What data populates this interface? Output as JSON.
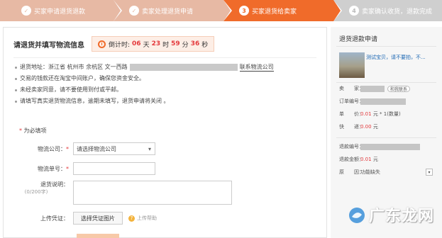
{
  "steps": [
    {
      "num": "✓",
      "label": "买家申请退货退款",
      "state": "done"
    },
    {
      "num": "✓",
      "label": "卖家处理退货申请",
      "state": "done"
    },
    {
      "num": "3",
      "label": "买家退货给卖家",
      "state": "active"
    },
    {
      "num": "4",
      "label": "卖家确认收货，退款完成",
      "state": "todo"
    }
  ],
  "main": {
    "title": "请退货并填写物流信息",
    "countdown": {
      "label": "倒计时:",
      "days": "06",
      "days_unit": "天",
      "hours": "23",
      "hours_unit": "时",
      "minutes": "59",
      "minutes_unit": "分",
      "seconds": "36",
      "seconds_unit": "秒"
    },
    "info": {
      "address_label": "退货地址：浙江省 杭州市 余杭区 文一西路",
      "logistics_link": "联系物流公司",
      "line2": "交易的钱款还在淘宝中间账户，确保您资金安全。",
      "line3": "未经卖家同意，请不要使用到付或平邮。",
      "line4": "请填写真实退货物流信息，逾期未填写，退货申请将关闭 。"
    },
    "required_note": "为必填项",
    "form": {
      "company_label": "物流公司：",
      "company_value": "请选择物流公司",
      "tracking_label": "物流单号：",
      "desc_label": "退货说明：",
      "desc_counter": "(0/200字)",
      "upload_label": "上传凭证：",
      "upload_button": "选择凭证图片",
      "upload_help": "上传帮助"
    }
  },
  "sidebar": {
    "title": "退货退款申请",
    "product_link": "测试宝贝，请不要拍，不...",
    "seller_label": "卖　　家：",
    "contact_button": "和我联系",
    "order_label": "订单编号：",
    "price_label": "单　　价：",
    "price_value": "0.01",
    "price_suffix": "元 * 1(数量)",
    "shipping_label": "快　　递：",
    "shipping_value": "0.00",
    "shipping_unit": "元",
    "refund_no_label": "退款编号：",
    "refund_amount_label": "退款金额：",
    "refund_amount_value": "0.01",
    "refund_amount_unit": "元",
    "reason_label": "原　　因：",
    "reason_value": "功能缺失"
  },
  "watermark": {
    "text": "广东龙网"
  },
  "colors": {
    "accent": "#f06b2a",
    "done": "#e7b9a4",
    "todo": "#cfcfcf",
    "price": "#e4393c",
    "link": "#1a66b3"
  }
}
